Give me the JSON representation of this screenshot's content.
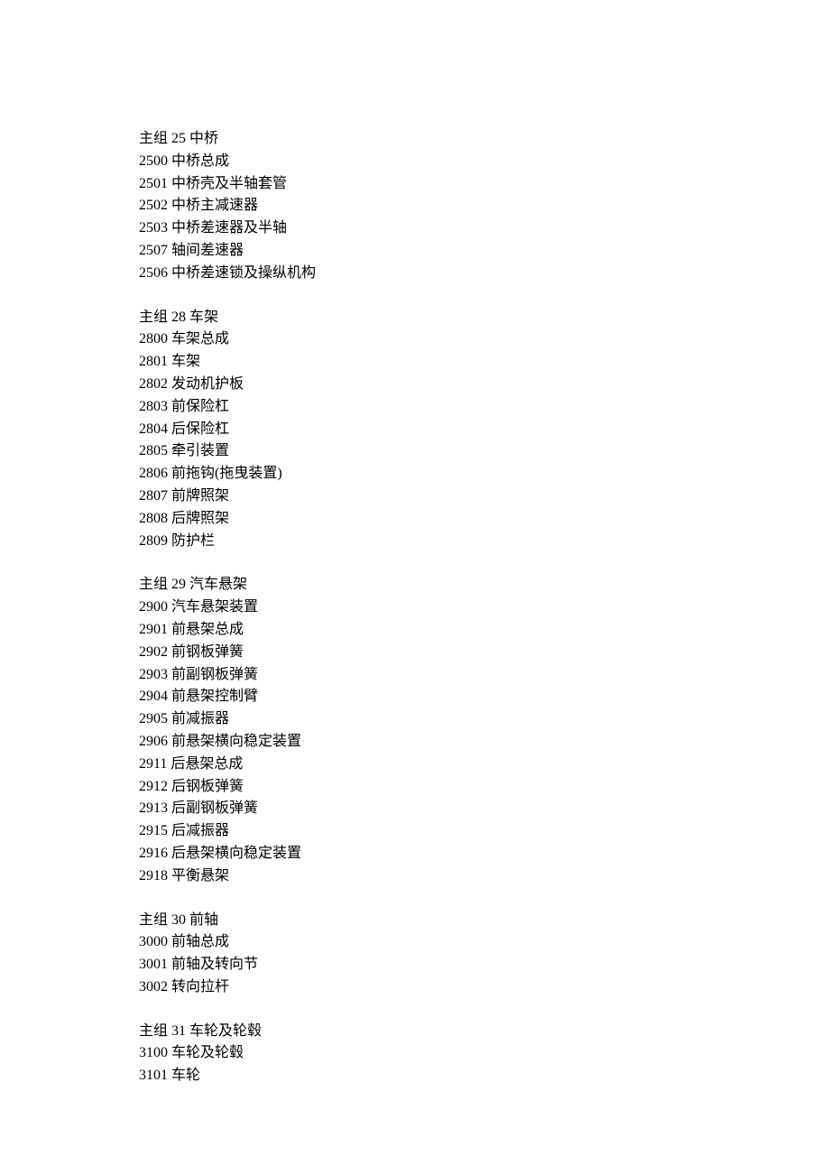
{
  "groups": [
    {
      "header_prefix": "主组 ",
      "header_num": "25",
      "header_name": " 中桥",
      "items": [
        {
          "code": "2500",
          "name": "中桥总成"
        },
        {
          "code": "2501",
          "name": "中桥壳及半轴套管"
        },
        {
          "code": "2502",
          "name": "中桥主减速器"
        },
        {
          "code": "2503",
          "name": "中桥差速器及半轴"
        },
        {
          "code": "2507",
          "name": "轴间差速器"
        },
        {
          "code": "2506",
          "name": "中桥差速锁及操纵机构"
        }
      ]
    },
    {
      "header_prefix": "主组 ",
      "header_num": "28",
      "header_name": " 车架",
      "items": [
        {
          "code": "2800",
          "name": "车架总成"
        },
        {
          "code": "2801",
          "name": "车架"
        },
        {
          "code": "2802",
          "name": "发动机护板"
        },
        {
          "code": "2803",
          "name": "前保险杠"
        },
        {
          "code": "2804",
          "name": "后保险杠"
        },
        {
          "code": "2805",
          "name": "牵引装置"
        },
        {
          "code": "2806",
          "name": "前拖钩(拖曳装置)"
        },
        {
          "code": "2807",
          "name": "前牌照架"
        },
        {
          "code": "2808",
          "name": "后牌照架"
        },
        {
          "code": "2809",
          "name": "防护栏"
        }
      ]
    },
    {
      "header_prefix": "主组 ",
      "header_num": "29",
      "header_name": " 汽车悬架",
      "items": [
        {
          "code": "2900",
          "name": "汽车悬架装置"
        },
        {
          "code": "2901",
          "name": "前悬架总成"
        },
        {
          "code": "2902",
          "name": "前钢板弹簧"
        },
        {
          "code": "2903",
          "name": "前副钢板弹簧"
        },
        {
          "code": "2904",
          "name": "前悬架控制臂"
        },
        {
          "code": "2905",
          "name": "前减振器"
        },
        {
          "code": "2906",
          "name": "前悬架横向稳定装置"
        },
        {
          "code": "2911",
          "name": "后悬架总成"
        },
        {
          "code": "2912",
          "name": "后钢板弹簧"
        },
        {
          "code": "2913",
          "name": "后副钢板弹簧"
        },
        {
          "code": "2915",
          "name": "后减振器"
        },
        {
          "code": "2916",
          "name": "后悬架横向稳定装置"
        },
        {
          "code": "2918",
          "name": "平衡悬架"
        }
      ]
    },
    {
      "header_prefix": "主组 ",
      "header_num": "30",
      "header_name": " 前轴",
      "items": [
        {
          "code": "3000",
          "name": "前轴总成"
        },
        {
          "code": "3001",
          "name": "前轴及转向节"
        },
        {
          "code": "3002",
          "name": "转向拉杆"
        }
      ]
    },
    {
      "header_prefix": "主组 ",
      "header_num": "31",
      "header_name": " 车轮及轮毂",
      "items": [
        {
          "code": "3100",
          "name": "车轮及轮毂"
        },
        {
          "code": "3101",
          "name": "车轮"
        }
      ]
    }
  ]
}
